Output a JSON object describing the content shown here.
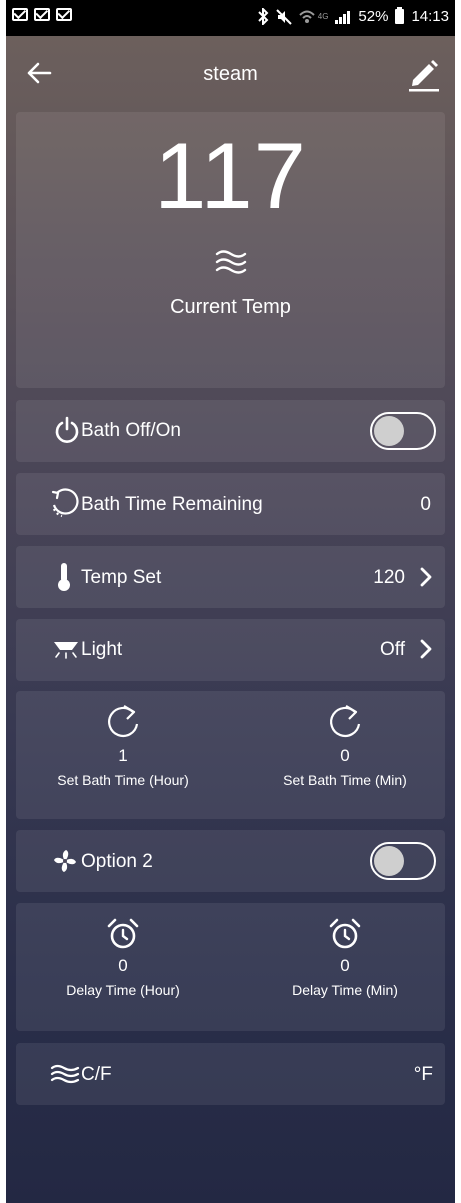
{
  "status_bar": {
    "signal_label": "4G",
    "battery": "52%",
    "time": "14:13"
  },
  "app_bar": {
    "title": "steam"
  },
  "current": {
    "value": "117",
    "label": "Current Temp"
  },
  "rows": {
    "bath_onoff": {
      "label": "Bath Off/On",
      "state": "off"
    },
    "bath_time_remaining": {
      "label": "Bath Time Remaining",
      "value": "0"
    },
    "temp_set": {
      "label": "Temp Set",
      "value": "120"
    },
    "light": {
      "label": "Light",
      "value": "Off"
    },
    "option2": {
      "label": "Option 2",
      "state": "off"
    },
    "cf": {
      "label": "C/F",
      "value": "°F"
    }
  },
  "bath_time": {
    "hour": {
      "value": "1",
      "label": "Set Bath Time (Hour)"
    },
    "min": {
      "value": "0",
      "label": "Set Bath Time (Min)"
    }
  },
  "delay_time": {
    "hour": {
      "value": "0",
      "label": "Delay Time (Hour)"
    },
    "min": {
      "value": "0",
      "label": "Delay Time (Min)"
    }
  },
  "colors": {
    "accent": "#ffffff",
    "bg_top": "#6f625d",
    "bg_bottom": "#232843"
  },
  "icons": [
    "mail-icon",
    "bluetooth-icon",
    "mute-icon",
    "wifi-icon",
    "signal-icon",
    "battery-icon",
    "back-arrow-icon",
    "edit-pencil-icon",
    "steam-icon",
    "power-icon",
    "timer-icon",
    "thermometer-icon",
    "lamp-icon",
    "chevron-right-icon",
    "refresh-icon",
    "fan-icon",
    "alarm-clock-icon"
  ]
}
